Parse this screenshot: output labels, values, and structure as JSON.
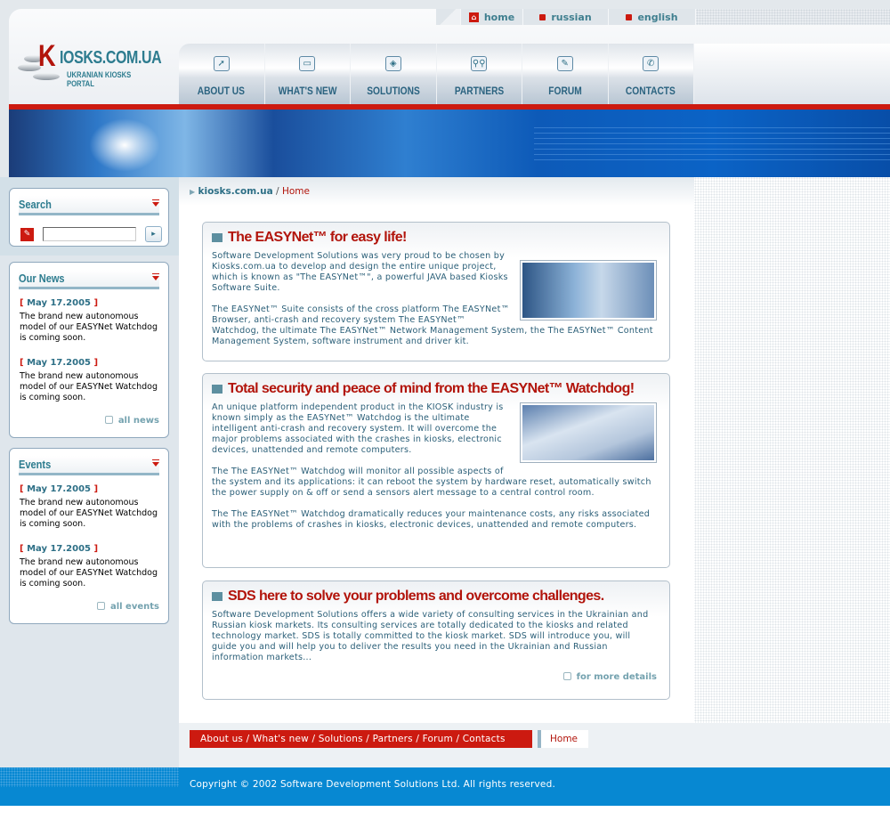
{
  "topbar": {
    "home": "home",
    "russian": "russian",
    "english": "english"
  },
  "logo": {
    "k": "K",
    "rest": "IOSKS.COM.UA",
    "sub": "UKRANIAN KIOSKS PORTAL"
  },
  "nav": [
    {
      "label": "ABOUT US",
      "icon": "pointer-icon",
      "glyph": "➚"
    },
    {
      "label": "WHAT'S NEW",
      "icon": "monitor-icon",
      "glyph": "▭"
    },
    {
      "label": "SOLUTIONS",
      "icon": "box-icon",
      "glyph": "◈"
    },
    {
      "label": "PARTNERS",
      "icon": "people-icon",
      "glyph": "⚲⚲"
    },
    {
      "label": "FORUM",
      "icon": "edit-icon",
      "glyph": "✎"
    },
    {
      "label": "CONTACTS",
      "icon": "phone-icon",
      "glyph": "✆"
    }
  ],
  "search": {
    "title": "Search",
    "value": "",
    "placeholder": ""
  },
  "news": {
    "title": "Our News",
    "items": [
      {
        "date": "May 17.2005",
        "text": "The brand new autonomous model of our EASYNet Watchdog is coming soon."
      },
      {
        "date": "May 17.2005",
        "text": "The brand new autonomous model of our EASYNet Watchdog is coming soon."
      }
    ],
    "more": "all news"
  },
  "events": {
    "title": "Events",
    "items": [
      {
        "date": "May 17.2005",
        "text": "The brand new autonomous model of our EASYNet Watchdog is coming soon."
      },
      {
        "date": "May 17.2005",
        "text": "The brand new autonomous model of our EASYNet Watchdog is coming soon."
      }
    ],
    "more": "all events"
  },
  "breadcrumb": {
    "root": "kiosks.com.ua",
    "sep": "/",
    "current": "Home"
  },
  "articles": [
    {
      "title": "The EASYNet™ for easy life!",
      "paragraphs": [
        "Software Development Solutions was very proud to be chosen by Kiosks.com.ua to develop and design the entire unique project, which is known as \"The EASYNet™\", a powerful JAVA based Kiosks Software Suite.",
        "The EASYNet™ Suite consists of the cross platform The EASYNet™ Browser, anti-crash and recovery system The EASYNet™ Watchdog, the ultimate The EASYNet™ Network Management System, the The EASYNet™ Content Management System, software instrument and driver kit."
      ]
    },
    {
      "title": "Total security and peace of mind from the EASYNet™ Watchdog!",
      "paragraphs": [
        "An unique platform independent product in the KIOSK industry is known simply as the EASYNet™ Watchdog is the ultimate intelligent anti-crash and recovery system. It will overcome the major problems associated with the crashes in kiosks, electronic devices, unattended and remote computers.",
        "The The EASYNet™ Watchdog will monitor all possible aspects of the system and its applications: it can reboot the system by hardware reset, automatically switch the power supply on & off or send a sensors alert message to a central control room.",
        "The The EASYNet™ Watchdog dramatically reduces your maintenance costs, any risks associated with the problems of crashes in kiosks, electronic devices, unattended and remote computers."
      ]
    },
    {
      "title": "SDS here to solve your problems and overcome challenges.",
      "paragraphs": [
        "Software Development Solutions offers a wide variety of consulting services in the Ukrainian and Russian kiosk markets. Its consulting services are totally dedicated to the kiosks and related technology market. SDS is totally committed to the kiosk market. SDS will introduce you, will guide you and will help you to deliver the results you need in the Ukrainian and Russian information markets..."
      ],
      "more": "for more details"
    }
  ],
  "footer": {
    "links": "About us / What's new / Solutions / Partners / Forum / Contacts",
    "home": "Home",
    "copyright": "Copyright © 2002 Software Development Solutions Ltd. All rights reserved."
  },
  "colors": {
    "accent_red": "#cc1a10",
    "teal": "#2d7c8f",
    "footer_blue": "#0788d2"
  }
}
